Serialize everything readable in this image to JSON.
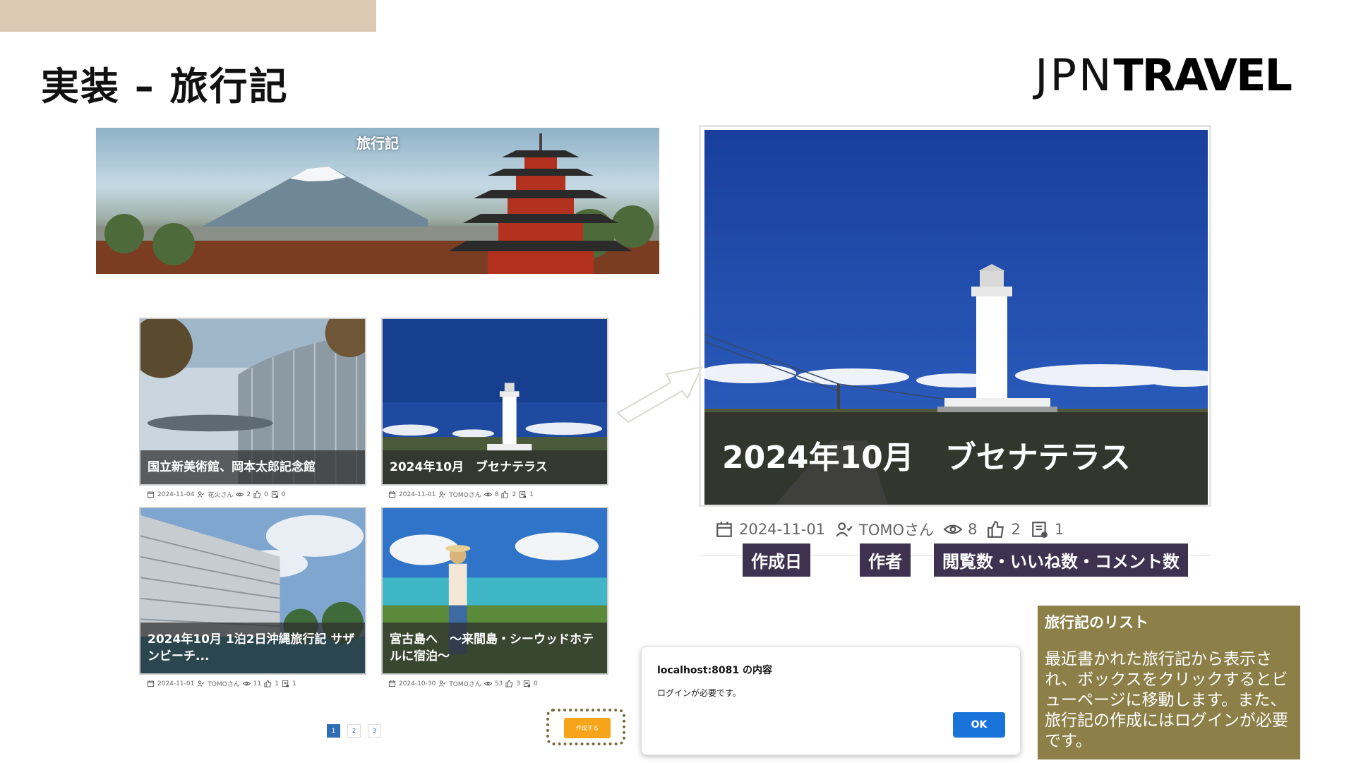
{
  "slide": {
    "title": "実装 – 旅行記",
    "brand_thin": "JPN",
    "brand_bold": "TRAVEL"
  },
  "hero": {
    "title": "旅行記"
  },
  "cards": [
    {
      "caption": "国立新美術館、岡本太郎記念館",
      "date": "2024-11-04",
      "author": "花火さん",
      "views": "2",
      "likes": "0",
      "comments": "0"
    },
    {
      "caption": "2024年10月　ブセナテラス",
      "date": "2024-11-01",
      "author": "TOMOさん",
      "views": "8",
      "likes": "2",
      "comments": "1"
    },
    {
      "caption": "2024年10月 1泊2日沖縄旅行記 サザンビーチ...",
      "date": "2024-11-01",
      "author": "TOMOさん",
      "views": "11",
      "likes": "1",
      "comments": "1"
    },
    {
      "caption": "宮古島へ　～来間島・シーウッドホテルに宿泊～",
      "date": "2024-10-30",
      "author": "TOMOさん",
      "views": "53",
      "likes": "3",
      "comments": "0"
    }
  ],
  "pagination": {
    "pages": [
      "1",
      "2",
      "3"
    ],
    "active": "1"
  },
  "create_button": "作成する",
  "detail": {
    "caption": "2024年10月　ブセナテラス",
    "date": "2024-11-01",
    "author": "TOMOさん",
    "views": "8",
    "likes": "2",
    "comments": "1",
    "tag_date": "作成日",
    "tag_author": "作者",
    "tag_stats": "閲覧数・いいね数・コメント数"
  },
  "dialog": {
    "title": "localhost:8081 の内容",
    "message": "ログインが必要です。",
    "ok": "OK"
  },
  "note": {
    "title": "旅行記のリスト",
    "body": "最近書かれた旅行記から表示され、ボックスをクリックするとビューページに移動します。また、旅行記の作成にはログインが必要です。"
  },
  "colors": {
    "topbar": "#dcc9b3",
    "tag_bg": "#3f3250",
    "note_bg": "#8d7f48",
    "ok_button": "#1a73d9",
    "create_button": "#f6a51b",
    "page_active": "#2f6db5"
  },
  "icons": [
    "calendar-icon",
    "user-check-icon",
    "eye-icon",
    "thumbs-up-icon",
    "comment-icon"
  ]
}
